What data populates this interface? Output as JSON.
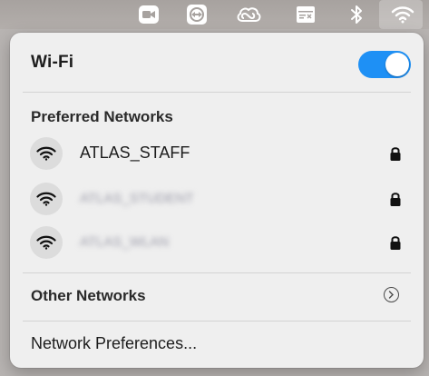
{
  "menubar": {
    "icons": [
      "video-camera-icon",
      "teamviewer-icon",
      "creative-cloud-icon",
      "keyboard-input-icon",
      "bluetooth-icon",
      "wifi-icon"
    ]
  },
  "wifi": {
    "title": "Wi-Fi",
    "enabled": true,
    "accent": "#1e90f5"
  },
  "preferred": {
    "header": "Preferred Networks",
    "networks": [
      {
        "name": "ATLAS_STAFF",
        "secured": true,
        "obscured": false
      },
      {
        "name": "ATLAS_STUDENT",
        "secured": true,
        "obscured": true
      },
      {
        "name": "ATLAS_WLAN",
        "secured": true,
        "obscured": true
      }
    ]
  },
  "other": {
    "label": "Other Networks"
  },
  "preferences": {
    "label": "Network Preferences..."
  }
}
